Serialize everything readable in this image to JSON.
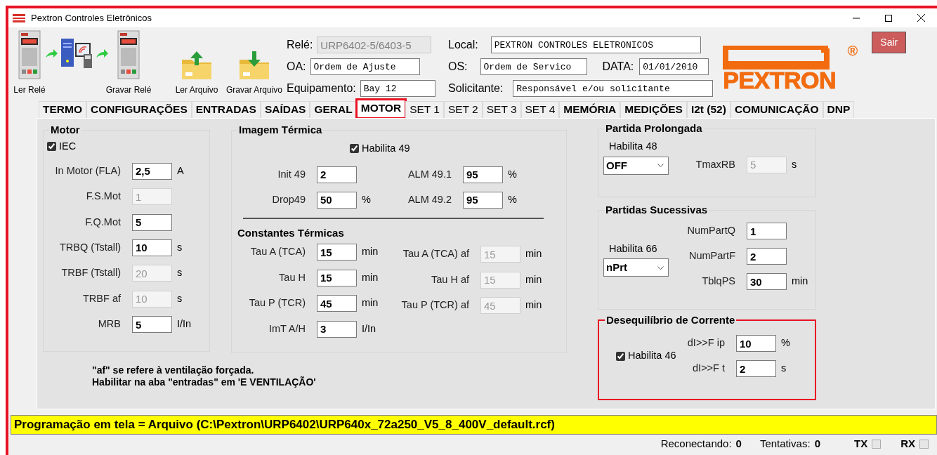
{
  "window": {
    "title": "Pextron Controles Eletrônicos"
  },
  "toolbar": [
    {
      "kind": "relay-read",
      "label": "Ler Relé"
    },
    {
      "kind": "relay-write",
      "label": "Gravar Relé"
    },
    {
      "kind": "folder-up",
      "label": "Ler Arquivo"
    },
    {
      "kind": "folder-down",
      "label": "Gravar Arquivo"
    }
  ],
  "header_left": [
    {
      "label": "Relé:",
      "value": "URP6402-5/6403-5",
      "disabled": true
    },
    {
      "label": "OA:",
      "value": "Ordem de Ajuste",
      "disabled": false
    },
    {
      "label": "Equipamento:",
      "value": "Bay 12",
      "disabled": false
    }
  ],
  "header_right": [
    {
      "fields": [
        {
          "label": "Local:",
          "value": "PEXTRON CONTROLES ELETRONICOS",
          "disabled": false
        }
      ]
    },
    {
      "fields": [
        {
          "label": "OS:",
          "value": "Ordem de Servico",
          "disabled": false
        },
        {
          "label": "DATA:",
          "value": "01/01/2010",
          "disabled": false
        }
      ]
    },
    {
      "fields": [
        {
          "label": "Solicitante:",
          "value": "Responsável e/ou solicitante",
          "disabled": false
        }
      ]
    }
  ],
  "logo": {
    "text": "PEXTRON",
    "mark": "®"
  },
  "exit_button": "Sair",
  "tabs": [
    {
      "label": "TERMO",
      "bold": true,
      "selected": false,
      "highlighted": false
    },
    {
      "label": "CONFIGURAÇÕES",
      "bold": true,
      "selected": false,
      "highlighted": false
    },
    {
      "label": "ENTRADAS",
      "bold": true,
      "selected": false,
      "highlighted": false
    },
    {
      "label": "SAÍDAS",
      "bold": true,
      "selected": false,
      "highlighted": false
    },
    {
      "label": "GERAL",
      "bold": true,
      "selected": false,
      "highlighted": false
    },
    {
      "label": "MOTOR",
      "bold": true,
      "selected": true,
      "highlighted": true
    },
    {
      "label": "SET 1",
      "bold": false,
      "selected": false,
      "highlighted": false
    },
    {
      "label": "SET 2",
      "bold": false,
      "selected": false,
      "highlighted": false
    },
    {
      "label": "SET 3",
      "bold": false,
      "selected": false,
      "highlighted": false
    },
    {
      "label": "SET 4",
      "bold": false,
      "selected": false,
      "highlighted": false
    },
    {
      "label": "MEMÓRIA",
      "bold": true,
      "selected": false,
      "highlighted": false
    },
    {
      "label": "MEDIÇÕES",
      "bold": true,
      "selected": false,
      "highlighted": false
    },
    {
      "label": "I2t (52)",
      "bold": true,
      "selected": false,
      "highlighted": false
    },
    {
      "label": "COMUNICAÇÃO",
      "bold": true,
      "selected": false,
      "highlighted": false
    },
    {
      "label": "DNP",
      "bold": true,
      "selected": false,
      "highlighted": false
    }
  ],
  "motor": {
    "title": "Motor",
    "highlighted": false,
    "checkbox": {
      "label": "IEC",
      "checked": true
    },
    "fields": [
      {
        "label": "In Motor (FLA)",
        "value": "2,5",
        "unit": "A",
        "disabled": false
      },
      {
        "label": "F.S.Mot",
        "value": "1",
        "disabled": true
      },
      {
        "label": "F.Q.Mot",
        "value": "5",
        "disabled": false
      },
      {
        "label": "TRBQ (Tstall)",
        "value": "10",
        "unit": "s",
        "disabled": false
      },
      {
        "label": "TRBF (Tstall)",
        "value": "20",
        "unit": "s",
        "disabled": true
      },
      {
        "label": "TRBF af",
        "value": "10",
        "unit": "s",
        "disabled": true
      },
      {
        "label": "MRB",
        "value": "5",
        "unit": "I/In",
        "disabled": false
      }
    ]
  },
  "thermal": {
    "title": "Imagem Térmica",
    "highlighted": false,
    "checkbox": {
      "label": "Habilita 49",
      "checked": true
    },
    "fields": [
      {
        "label": "Init 49",
        "value": "2",
        "disabled": false
      },
      {
        "label": "ALM 49.1",
        "value": "95",
        "unit": "%",
        "disabled": false
      },
      {
        "label": "Drop49",
        "value": "50",
        "unit": "%",
        "disabled": false
      },
      {
        "label": "ALM 49.2",
        "value": "95",
        "unit": "%",
        "disabled": false
      }
    ],
    "subtitle": "Constantes Térmicas",
    "constants_left": [
      {
        "label": "Tau A (TCA)",
        "value": "15",
        "unit": "min",
        "disabled": false
      },
      {
        "label": "Tau H",
        "value": "15",
        "unit": "min",
        "disabled": false
      },
      {
        "label": "Tau P (TCR)",
        "value": "45",
        "unit": "min",
        "disabled": false
      },
      {
        "label": "ImT A/H",
        "value": "3",
        "unit": "I/In",
        "disabled": false
      }
    ],
    "constants_right": [
      {
        "label": "Tau A (TCA) af",
        "value": "15",
        "unit": "min",
        "disabled": true
      },
      {
        "label": "Tau H af",
        "value": "15",
        "unit": "min",
        "disabled": true
      },
      {
        "label": "Tau P (TCR) af",
        "value": "45",
        "unit": "min",
        "disabled": true
      }
    ]
  },
  "note": [
    "\"af\" se refere à ventilação forçada.",
    "Habilitar na aba \"entradas\" em 'E VENTILAÇÃO'"
  ],
  "long_start": {
    "title": "Partida Prolongada",
    "highlighted": false,
    "dropdown": {
      "label": "Habilita 48",
      "value": "OFF"
    },
    "fields": [
      {
        "label": "TmaxRB",
        "value": "5",
        "unit": "s",
        "disabled": true
      }
    ]
  },
  "successive_starts": {
    "title": "Partidas Sucessivas",
    "highlighted": false,
    "dropdown": {
      "label": "Habilita 66",
      "value": "nPrt"
    },
    "fields": [
      {
        "label": "NumPartQ",
        "value": "1",
        "disabled": false
      },
      {
        "label": "NumPartF",
        "value": "2",
        "disabled": false
      },
      {
        "label": "TblqPS",
        "value": "30",
        "unit": "min",
        "disabled": false
      }
    ]
  },
  "unbalance": {
    "title": "Desequilíbrio de Corrente",
    "highlighted": true,
    "checkbox": {
      "label": "Habilita 46",
      "checked": true
    },
    "fields": [
      {
        "label": "dI>>F ip",
        "value": "10",
        "unit": "%",
        "disabled": false
      },
      {
        "label": "dI>>F t",
        "value": "2",
        "unit": "s",
        "disabled": false
      }
    ]
  },
  "status_line": "Programação em tela = Arquivo (C:\\Pextron\\URP6402\\URP640x_72a250_V5_8_400V_default.rcf)",
  "status_bar": {
    "counters": [
      {
        "label": "Reconectando:",
        "value": "0"
      },
      {
        "label": "Tentativas:",
        "value": "0"
      }
    ],
    "indicators": [
      {
        "label": "TX",
        "on": false
      },
      {
        "label": "RX",
        "on": false
      }
    ]
  }
}
